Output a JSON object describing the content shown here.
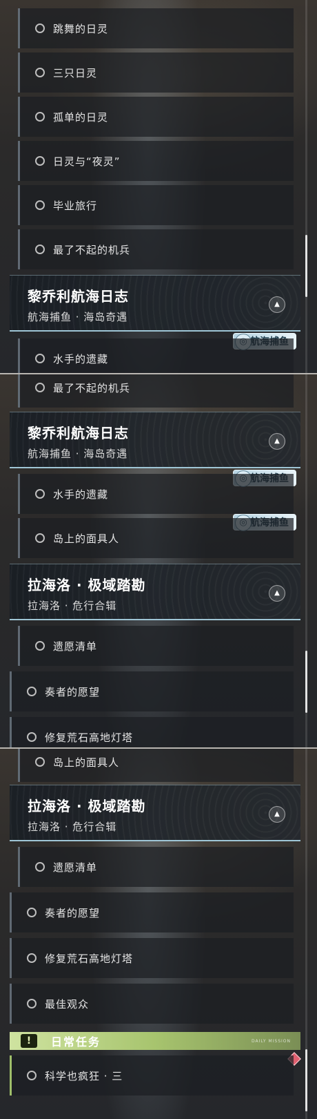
{
  "panel1": {
    "items": [
      "跳舞的日灵",
      "三只日灵",
      "孤单的日灵",
      "日灵与“夜灵”",
      "毕业旅行",
      "最了不起的机兵"
    ],
    "header": {
      "title": "黎乔利航海日志",
      "subtitle": "航海捕鱼 · 海岛奇遇",
      "collapse_icon": "▲"
    },
    "badge": "航海捕鱼",
    "partial_item": "水手的遗藏"
  },
  "panel2": {
    "top_item": "最了不起的机兵",
    "header1": {
      "title": "黎乔利航海日志",
      "subtitle": "航海捕鱼 · 海岛奇遇",
      "collapse_icon": "▲"
    },
    "badge1": "航海捕鱼",
    "item_a": "水手的遗藏",
    "badge2": "航海捕鱼",
    "item_b": "岛上的面具人",
    "header2": {
      "title": "拉海洛 · 极域踏勘",
      "subtitle": "拉海洛 · 危行合辑",
      "collapse_icon": "▲"
    },
    "item_c": "遗愿清单",
    "item_d": "奏者的愿望",
    "partial_item": "修复荒石高地灯塔"
  },
  "panel3": {
    "top_item": "岛上的面具人",
    "header": {
      "title": "拉海洛 · 极域踏勘",
      "subtitle": "拉海洛 · 危行合辑",
      "collapse_icon": "▲"
    },
    "sub_items": [
      "遗愿清单"
    ],
    "top_items": [
      "奏者的愿望",
      "修复荒石高地灯塔",
      "最佳观众"
    ],
    "daily": {
      "icon": "!",
      "label": "日常任务",
      "code": "DAILY MISSION"
    },
    "daily_item": "科学也疯狂 · 三"
  },
  "colors": {
    "accent_daily": "#a7c46e",
    "header_border": "#9fc6d6",
    "badge": "#b7d4e2"
  }
}
